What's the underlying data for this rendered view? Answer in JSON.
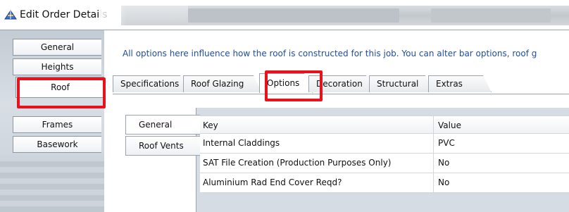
{
  "window": {
    "title": "Edit Order Details"
  },
  "sidebar": {
    "items": [
      {
        "label": "General"
      },
      {
        "label": "Heights"
      },
      {
        "label": "Roof"
      },
      {
        "label": "Frames"
      },
      {
        "label": "Basework"
      }
    ],
    "selected": "Roof"
  },
  "info": {
    "text": "All options here influence how the roof is constructed for this job. You can alter bar options, roof g"
  },
  "tabs": {
    "items": [
      {
        "label": "Specifications"
      },
      {
        "label": "Roof Glazing"
      },
      {
        "label": "Options"
      },
      {
        "label": "Decoration"
      },
      {
        "label": "Structural"
      },
      {
        "label": "Extras"
      }
    ],
    "selected": "Options"
  },
  "subtabs": {
    "items": [
      {
        "label": "General"
      },
      {
        "label": "Roof Vents"
      }
    ],
    "selected": "General"
  },
  "grid": {
    "columns": [
      {
        "label": "Key"
      },
      {
        "label": "Value"
      }
    ],
    "rows": [
      {
        "key": "Internal Claddings",
        "value": "PVC"
      },
      {
        "key": "SAT File Creation (Production Purposes Only)",
        "value": "No"
      },
      {
        "key": "Aluminium Rad End Cover Reqd?",
        "value": "No"
      }
    ]
  },
  "colors": {
    "highlight": "#e8121c",
    "info_text": "#1f4e9e"
  }
}
